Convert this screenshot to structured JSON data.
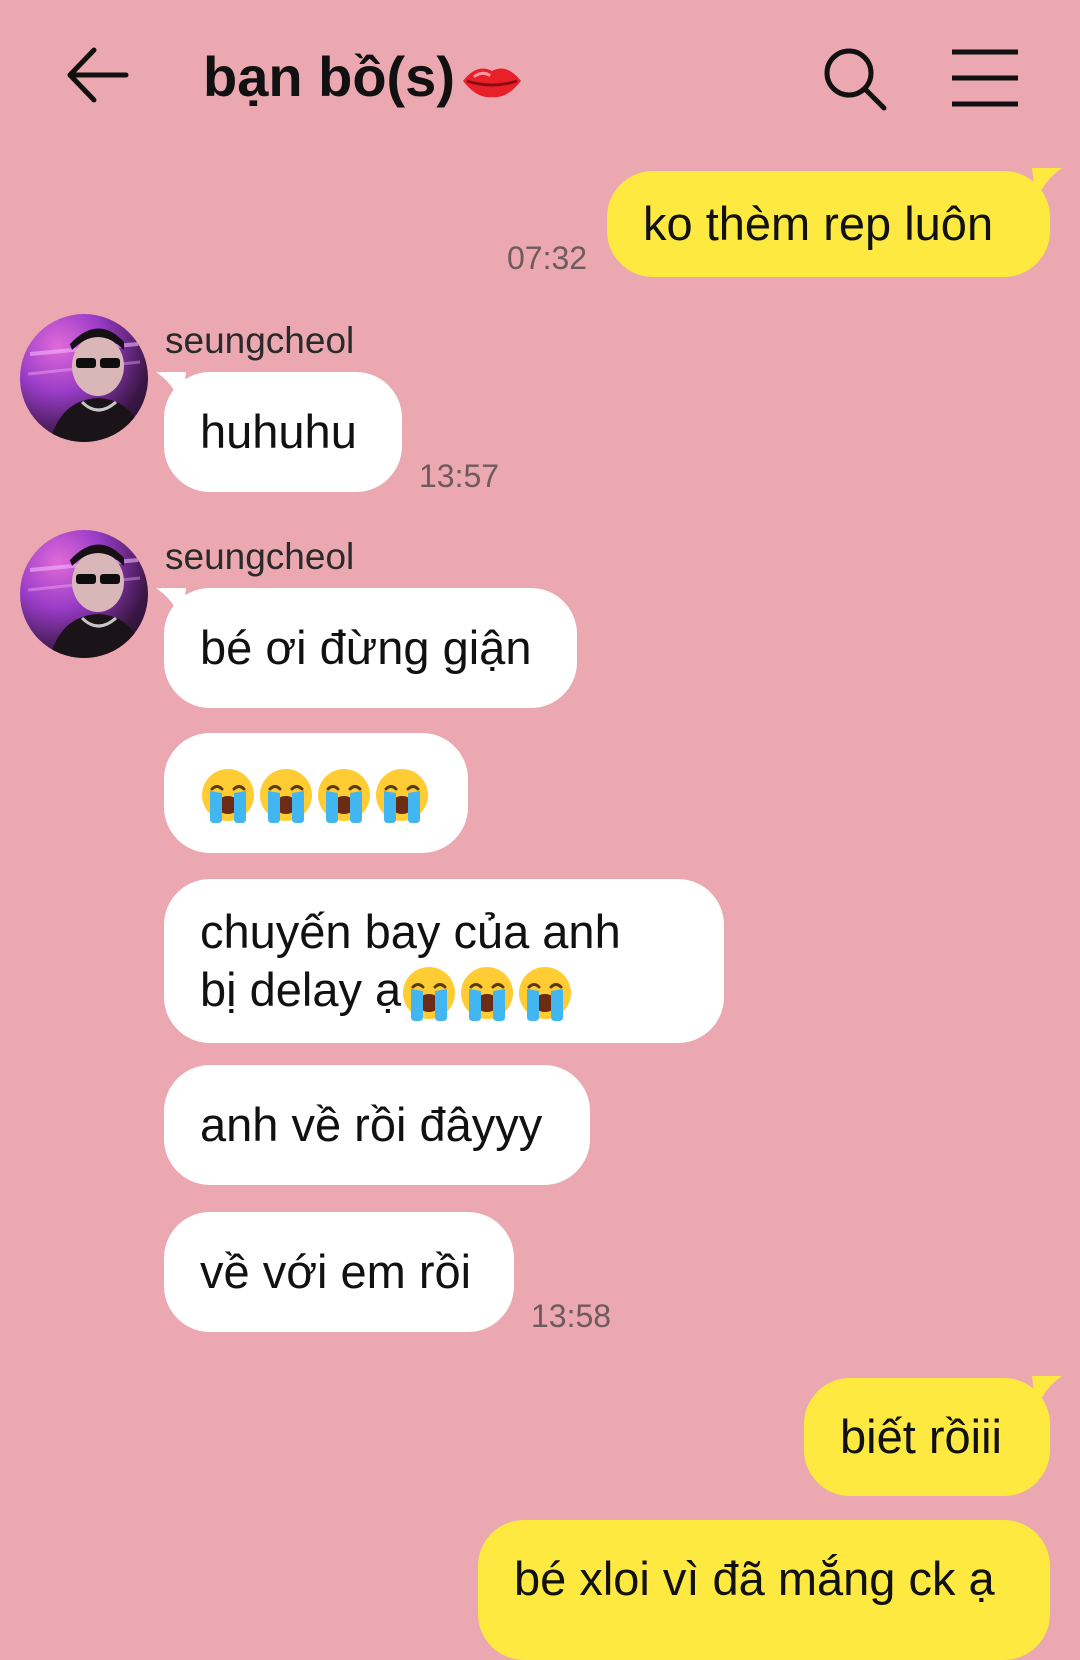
{
  "header": {
    "title": "bạn bồ(s)",
    "title_icon": "lips-icon",
    "back_icon": "back-arrow-icon",
    "search_icon": "search-icon",
    "menu_icon": "menu-icon"
  },
  "colors": {
    "background": "#eba8b1",
    "incoming_bubble": "#ffffff",
    "outgoing_bubble": "#fde93f"
  },
  "messages": [
    {
      "direction": "out",
      "text": "ko thèm rep luôn",
      "time": "07:32"
    },
    {
      "direction": "in",
      "sender": "seungcheol",
      "text": "huhuhu",
      "time": "13:57"
    },
    {
      "direction": "in",
      "sender": "seungcheol",
      "text": "bé ơi đừng giận"
    },
    {
      "direction": "in",
      "emoji": "loudly-crying-face x4"
    },
    {
      "direction": "in",
      "text_line1": "chuyến bay của anh",
      "text_line2": "bị delay ạ",
      "emoji": "loudly-crying-face x3"
    },
    {
      "direction": "in",
      "text": "anh về rồi đâyyy"
    },
    {
      "direction": "in",
      "text": "về với em rồi",
      "time": "13:58"
    },
    {
      "direction": "out",
      "text": "biết rồiii"
    },
    {
      "direction": "out",
      "text": "bé xloi vì đã mắng ck ạ"
    }
  ]
}
